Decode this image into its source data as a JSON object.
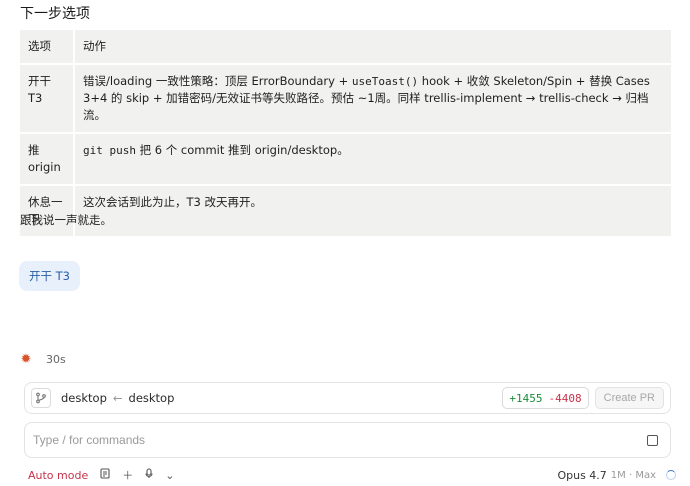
{
  "heading": "下一步选项",
  "table": {
    "header": {
      "c1": "选项",
      "c2": "动作"
    },
    "rows": [
      {
        "c1": "开干 T3",
        "c2_a": "错误/loading 一致性策略：顶层 ErrorBoundary + ",
        "c2_code": "useToast()",
        "c2_b": " hook + 收敛 Skeleton/Spin + 替换 Cases 3+4 的 skip + 加错密码/无效证书等失败路径。预估 ~1周。同样 trellis-implement → trellis-check → 归档流。"
      },
      {
        "c1": "推 origin",
        "c2_code": "git push",
        "c2_b": " 把 6 个 commit 推到 origin/desktop。"
      },
      {
        "c1": "休息一下",
        "c2_b": "这次会话到此为止，T3 改天再开。"
      }
    ]
  },
  "followup": "跟我说一声就走。",
  "user_message": "开干 T3",
  "status": {
    "elapsed": "30s"
  },
  "pr_bar": {
    "branch_from": "desktop",
    "branch_to": "desktop",
    "additions": "+1455",
    "deletions": "-4408",
    "create_pr": "Create PR"
  },
  "command": {
    "placeholder": "Type / for commands",
    "value": ""
  },
  "footer": {
    "mode": "Auto mode",
    "model": "Opus 4.7",
    "context": "1M · Max"
  },
  "icons": {
    "status": "sparkle-icon",
    "branch": "branch-icon",
    "stop": "stop-icon",
    "file": "file-icon",
    "add": "plus-icon",
    "mic": "mic-icon",
    "loading": "spinner-icon"
  },
  "colors": {
    "accent_red": "#c8324a",
    "addition_green": "#1a8d3a",
    "user_bubble": "#e8f1fb"
  }
}
